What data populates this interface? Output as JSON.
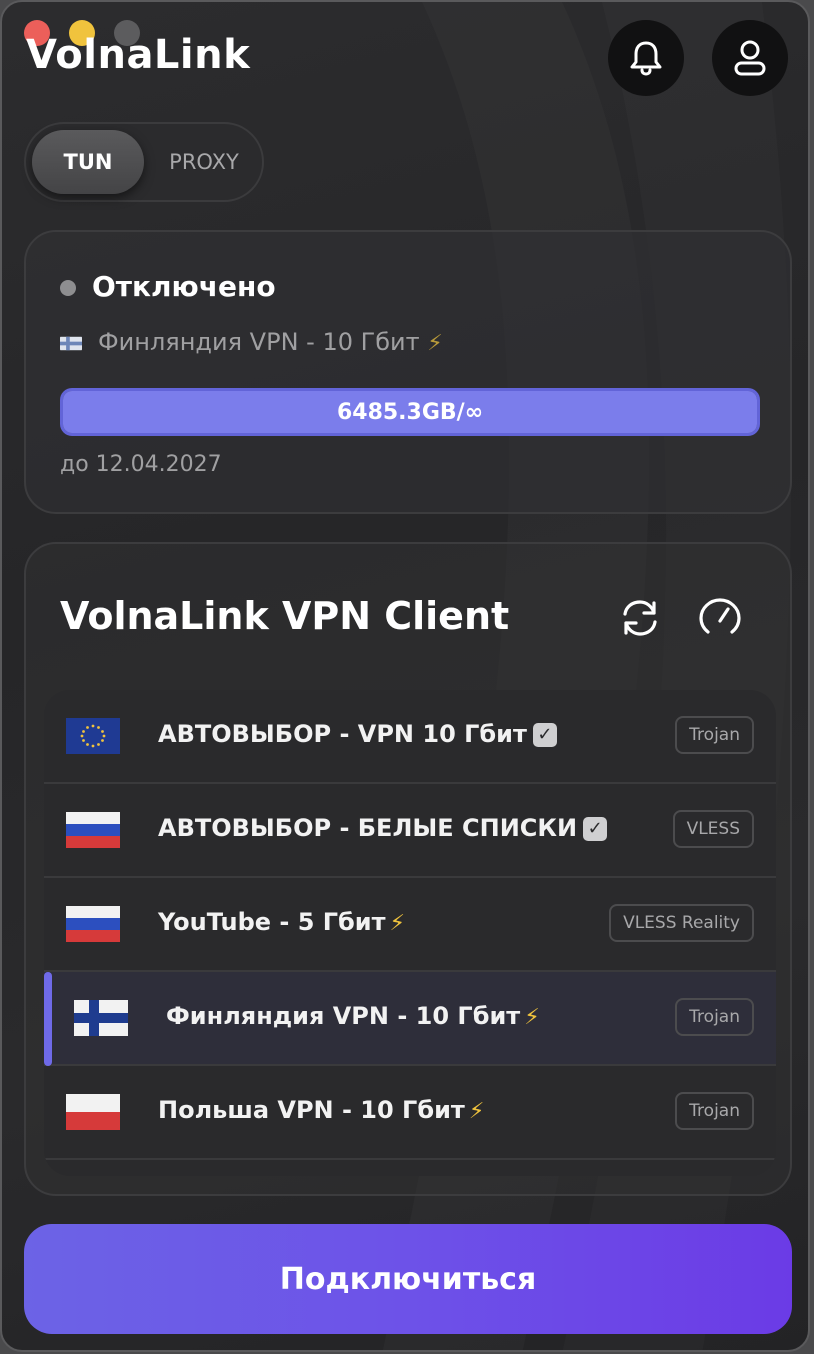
{
  "app": {
    "title": "VolnaLink"
  },
  "mode": {
    "tun_label": "TUN",
    "proxy_label": "PROXY",
    "selected": "TUN"
  },
  "status": {
    "state": "Отключено",
    "server_flag": "FI",
    "server_label": "Финляндия VPN - 10 Гбит",
    "traffic_label": "6485.3GB/∞",
    "traffic_fraction": 1.0,
    "expires": "до 12.04.2027"
  },
  "servers": {
    "title": "VolnaLink VPN Client",
    "items": [
      {
        "flag": "EU",
        "label": "АВТОВЫБОР - VPN 10 Гбит",
        "badge": "check",
        "protocol": "Trojan"
      },
      {
        "flag": "RU",
        "label": "АВТОВЫБОР - БЕЛЫЕ СПИСКИ",
        "badge": "check",
        "protocol": "VLESS"
      },
      {
        "flag": "RU",
        "label": "YouTube - 5 Гбит",
        "badge": "bolt",
        "protocol": "VLESS Reality"
      },
      {
        "flag": "FI",
        "label": "Финляндия VPN - 10 Гбит",
        "badge": "bolt",
        "protocol": "Trojan",
        "selected": true
      },
      {
        "flag": "PL",
        "label": "Польша VPN - 10 Гбит",
        "badge": "bolt",
        "protocol": "Trojan"
      }
    ]
  },
  "actions": {
    "connect_label": "Подключиться"
  },
  "icons": {
    "bell": "bell-icon",
    "user": "user-icon",
    "refresh": "refresh-icon",
    "speed": "speedometer-icon",
    "check": "checkmark-icon",
    "bolt": "lightning-icon"
  },
  "colors": {
    "accent": "#6f6ae8",
    "traffic_fill": "#7b7deb",
    "status_dot": "#8e8e90",
    "bolt": "#f0c33d",
    "connect_gradient_start": "#6c63e6",
    "connect_gradient_end": "#6b3be6"
  }
}
